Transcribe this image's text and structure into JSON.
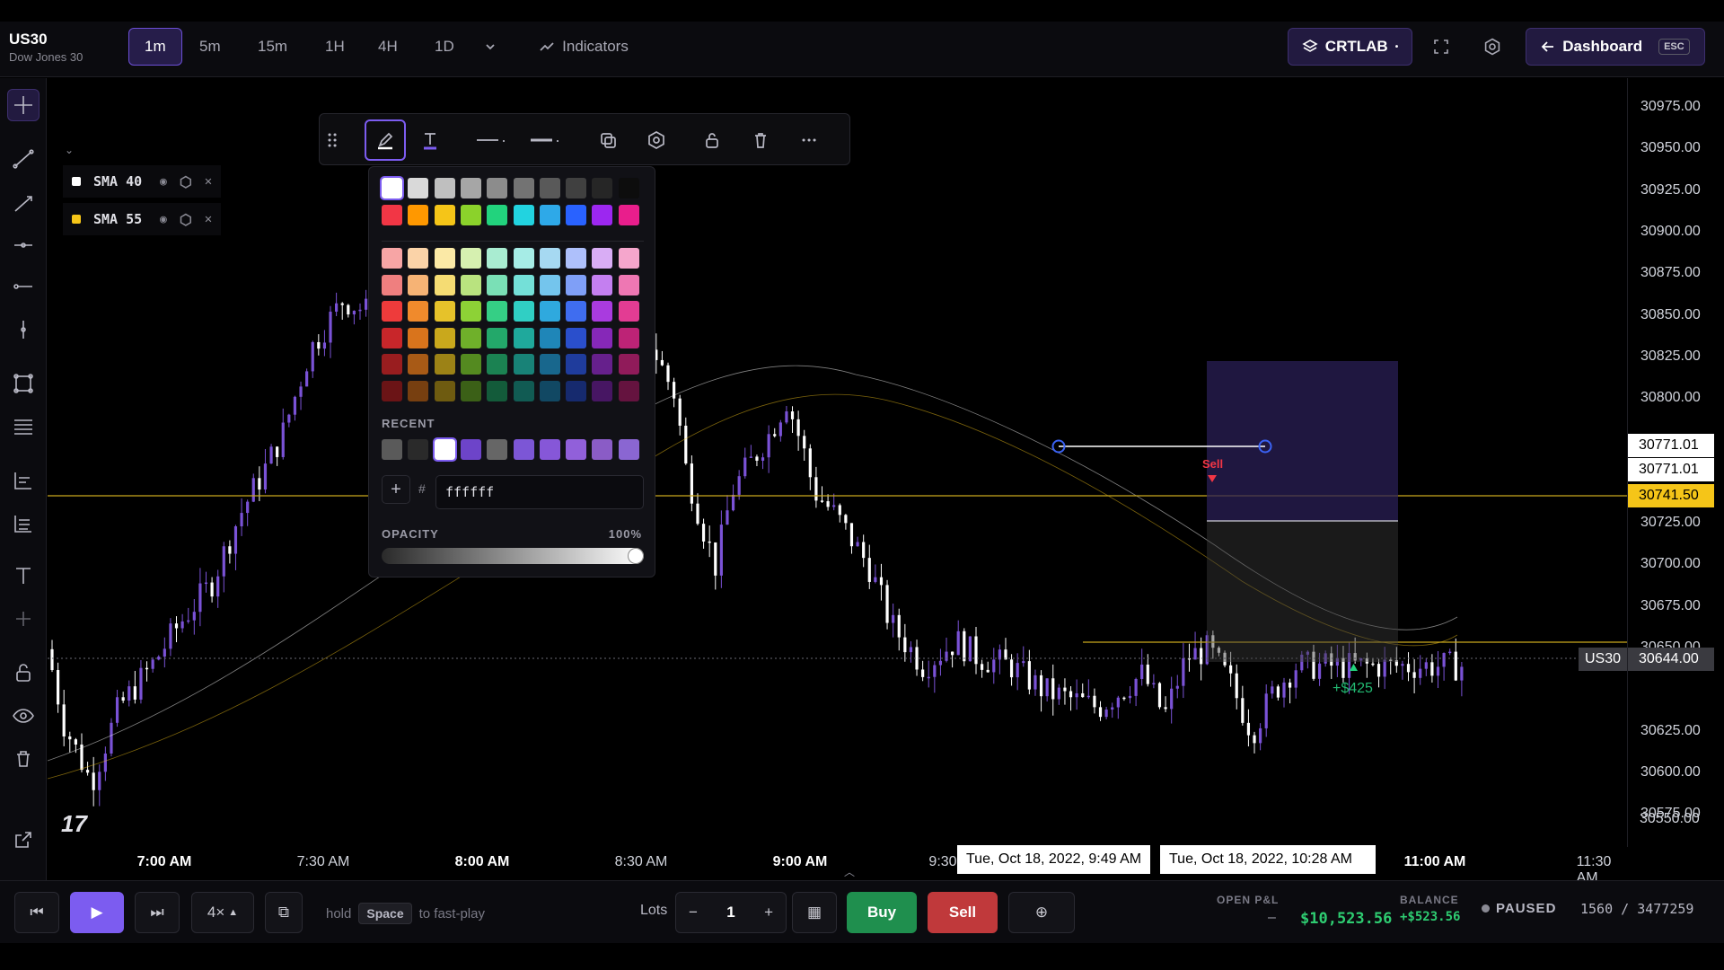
{
  "symbol": {
    "ticker": "US30",
    "name": "Dow Jones 30"
  },
  "timeframes": [
    {
      "label": "1m",
      "active": true
    },
    {
      "label": "5m"
    },
    {
      "label": "15m"
    },
    {
      "label": "1H"
    },
    {
      "label": "4H"
    },
    {
      "label": "1D"
    }
  ],
  "toolbar": {
    "indicators_label": "Indicators",
    "profile_label": "CRTLAB",
    "dashboard_label": "Dashboard",
    "esc_label": "ESC"
  },
  "left_tools": [
    "crosshair-icon",
    "trend-line-icon",
    "ray-icon",
    "horizontal-ray-icon",
    "horizontal-line-icon",
    "vertical-line-icon",
    "rectangle-icon",
    "fib-icon",
    "long-position-icon",
    "short-position-icon",
    "text-icon",
    "plus-icon",
    "lock-icon",
    "eye-icon",
    "trash-icon",
    "share-icon"
  ],
  "legend": {
    "items": [
      {
        "label": "SMA 40",
        "color": "#ffffff"
      },
      {
        "label": "SMA 55",
        "color": "#f5c518"
      }
    ]
  },
  "palette": {
    "grays": [
      "#ffffff",
      "#d9d9d9",
      "#bfbfbf",
      "#a6a6a6",
      "#8c8c8c",
      "#737373",
      "#595959",
      "#404040",
      "#262626",
      "#0d0d0d"
    ],
    "brights": [
      "#f23645",
      "#ff9800",
      "#f5c518",
      "#8bd22b",
      "#22d37d",
      "#22d3e0",
      "#2ea9e8",
      "#2962ff",
      "#9c27f0",
      "#e91e8c"
    ],
    "shades": [
      [
        "#f7a5a5",
        "#fbd3a8",
        "#fbe9a6",
        "#d6f0b0",
        "#a9ecd1",
        "#a6ece6",
        "#a6d9f2",
        "#aec0fb",
        "#d9adf5",
        "#f5a6cc"
      ],
      [
        "#ef7f7f",
        "#f6b375",
        "#f5dc73",
        "#b9e37f",
        "#7ae0b6",
        "#74e0d8",
        "#74c5ed",
        "#7f9ff7",
        "#c47ff0",
        "#ee77b3"
      ],
      [
        "#ee3b3b",
        "#f08a2c",
        "#e6c22a",
        "#8dd236",
        "#35cf85",
        "#30cfc4",
        "#2fa9de",
        "#3f6df0",
        "#a93bdf",
        "#e33c93"
      ],
      [
        "#c8262a",
        "#d9741c",
        "#c9a81c",
        "#6fb02a",
        "#23a86a",
        "#1fa99c",
        "#1f86b8",
        "#2a4fcc",
        "#8628b8",
        "#bd2376"
      ],
      [
        "#991d1f",
        "#a85a16",
        "#9c8216",
        "#548a20",
        "#1b8252",
        "#188277",
        "#18678d",
        "#1f3c9c",
        "#66208c",
        "#901b5a"
      ],
      [
        "#6b1416",
        "#773f10",
        "#6e5b10",
        "#3b6017",
        "#135b3a",
        "#115b53",
        "#114863",
        "#162a6e",
        "#471663",
        "#65133f"
      ]
    ],
    "recent_label": "RECENT",
    "recent": [
      "#5a5a5a",
      "#2a2a2a",
      "#ffffff",
      "#6d44c9",
      "#666666",
      "#7c56d6",
      "#8657d8",
      "#9160da",
      "#8a5cc6",
      "#8a66d2"
    ],
    "hex_hash": "#",
    "hex_value": "ffffff",
    "opacity_label": "OPACITY",
    "opacity_value": "100%"
  },
  "price_axis": {
    "labels": [
      "30975.00",
      "30950.00",
      "30925.00",
      "30900.00",
      "30875.00",
      "30850.00",
      "30825.00",
      "30800.00",
      "30725.00",
      "30700.00",
      "30675.00",
      "30650.00",
      "30625.00",
      "30600.00",
      "30575.00",
      "30550.00"
    ],
    "tags": [
      {
        "text": "30771.01",
        "kind": "white"
      },
      {
        "text": "30771.01",
        "kind": "white"
      },
      {
        "text": "30741.50",
        "kind": "yellow"
      },
      {
        "text": "30644.00",
        "kind": "gray"
      }
    ],
    "symbol_tag": "US30"
  },
  "time_axis": {
    "labels": [
      {
        "text": "7:00 AM",
        "bold": true
      },
      {
        "text": "7:30 AM"
      },
      {
        "text": "8:00 AM",
        "bold": true
      },
      {
        "text": "8:30 AM"
      },
      {
        "text": "9:00 AM",
        "bold": true
      },
      {
        "text": "9:30"
      },
      {
        "text": "11:00 AM",
        "bold": true
      },
      {
        "text": "11:30 AM"
      }
    ],
    "tooltips": [
      "Tue, Oct 18, 2022, 9:49 AM",
      "Tue, Oct 18, 2022, 10:28 AM"
    ]
  },
  "trade": {
    "sell_label": "Sell",
    "profit_label": "+$425"
  },
  "bottom": {
    "speed_label": "4×",
    "hold_text": "hold",
    "space_key": "Space",
    "fastplay_text": "to fast-play",
    "lots_label": "Lots",
    "lots_value": "1",
    "buy_label": "Buy",
    "sell_label": "Sell",
    "open_pl_label": "OPEN P&L",
    "open_pl_value": "–",
    "balance_label": "BALANCE",
    "balance_value": "$10,523.56",
    "balance_change": "+$523.56",
    "status": "PAUSED",
    "progress": "1560 / 3477259"
  },
  "colors": {
    "accent": "#7c5cf0",
    "buy": "#1f8f4e",
    "sell": "#c0393b",
    "up_candle": "#7a52d6",
    "down_candle": "#ffffff",
    "sma40": "#ffffff",
    "sma55": "#f5c518"
  }
}
